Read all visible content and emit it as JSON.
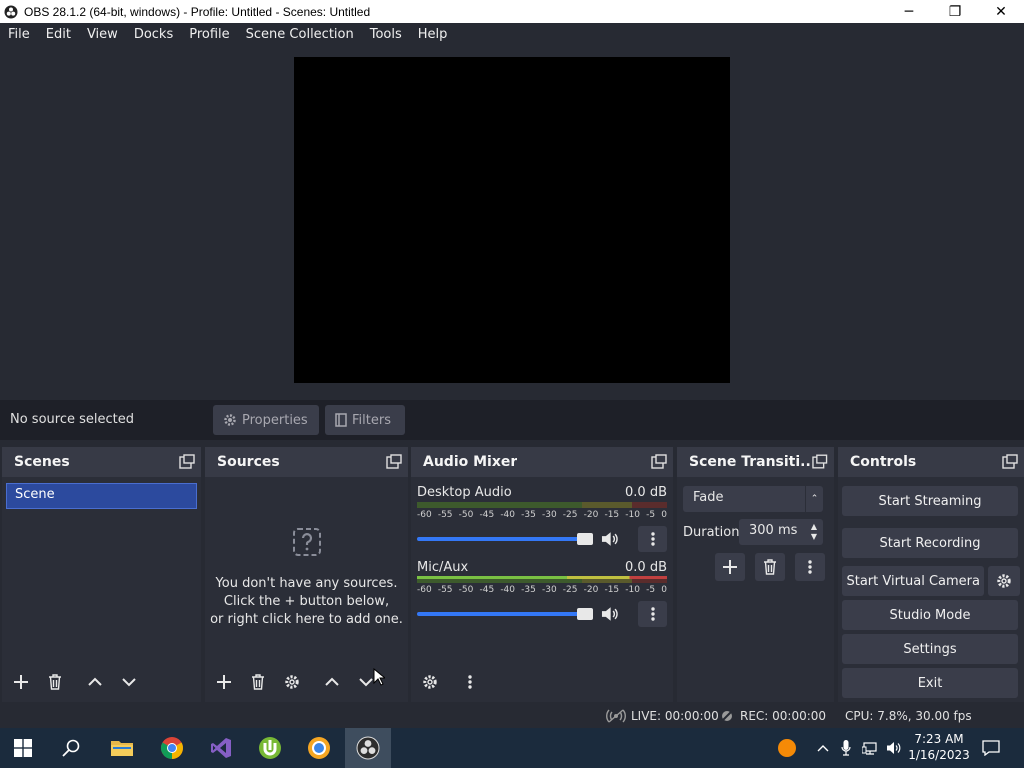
{
  "window": {
    "title": "OBS 28.1.2 (64-bit, windows) - Profile: Untitled - Scenes: Untitled",
    "minimize": "─",
    "maximize": "❐",
    "close": "✕"
  },
  "menu": [
    "File",
    "Edit",
    "View",
    "Docks",
    "Profile",
    "Scene Collection",
    "Tools",
    "Help"
  ],
  "context_bar": {
    "status": "No source selected",
    "properties_label": "Properties",
    "filters_label": "Filters"
  },
  "docks": {
    "scenes": {
      "title": "Scenes",
      "items": [
        "Scene"
      ]
    },
    "sources": {
      "title": "Sources",
      "empty_line1": "You don't have any sources.",
      "empty_line2": "Click the + button below,",
      "empty_line3": "or right click here to add one."
    },
    "audio_mixer": {
      "title": "Audio Mixer",
      "channels": [
        {
          "name": "Desktop Audio",
          "level": "0.0 dB"
        },
        {
          "name": "Mic/Aux",
          "level": "0.0 dB"
        }
      ],
      "scale": [
        "-60",
        "-55",
        "-50",
        "-45",
        "-40",
        "-35",
        "-30",
        "-25",
        "-20",
        "-15",
        "-10",
        "-5",
        "0"
      ]
    },
    "transitions": {
      "title": "Scene Transiti...",
      "selected": "Fade",
      "duration_label": "Duration",
      "duration_value": "300 ms"
    },
    "controls": {
      "title": "Controls",
      "start_streaming": "Start Streaming",
      "start_recording": "Start Recording",
      "start_virtual_camera": "Start Virtual Camera",
      "studio_mode": "Studio Mode",
      "settings": "Settings",
      "exit": "Exit"
    }
  },
  "status": {
    "live": "LIVE: 00:00:00",
    "rec": "REC: 00:00:00",
    "cpu": "CPU: 7.8%, 30.00 fps"
  },
  "taskbar": {
    "time": "7:23 AM",
    "date": "1/16/2023"
  }
}
